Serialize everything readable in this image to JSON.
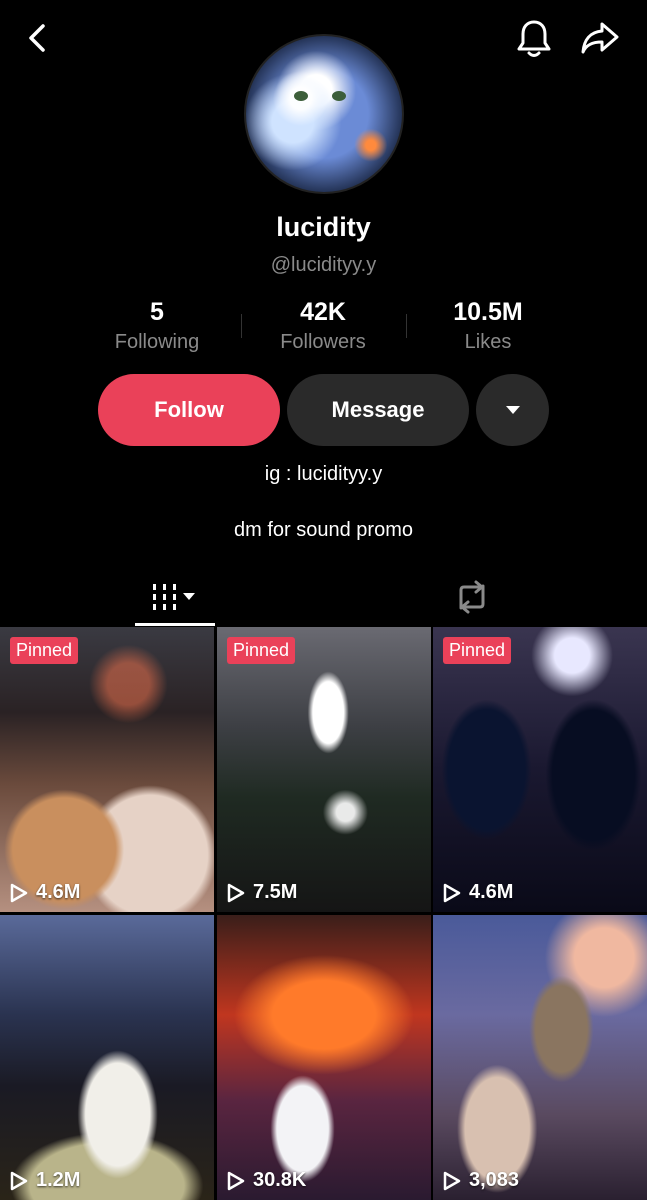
{
  "profile": {
    "name": "lucidity",
    "handle": "@lucidityy.y",
    "bio_line1": "ig : lucidityy.y",
    "bio_line2": "dm for sound promo"
  },
  "stats": [
    {
      "value": "5",
      "label": "Following"
    },
    {
      "value": "42K",
      "label": "Followers"
    },
    {
      "value": "10.5M",
      "label": "Likes"
    }
  ],
  "actions": {
    "follow": "Follow",
    "message": "Message"
  },
  "colors": {
    "accent": "#ea4159",
    "background": "#000000",
    "muted_text": "#8a8a8a",
    "button_dark": "#2a2a2a"
  },
  "icons": {
    "back": "chevron-left-icon",
    "notifications": "bell-icon",
    "share": "share-arrow-icon",
    "more": "triangle-down-icon",
    "videos_tab": "grid-bars-icon",
    "reposts_tab": "repost-icon",
    "play": "play-outline-icon"
  },
  "videos": [
    {
      "pinned": "Pinned",
      "views": "4.6M"
    },
    {
      "pinned": "Pinned",
      "views": "7.5M"
    },
    {
      "pinned": "Pinned",
      "views": "4.6M"
    },
    {
      "pinned": "",
      "views": "1.2M"
    },
    {
      "pinned": "",
      "views": "30.8K"
    },
    {
      "pinned": "",
      "views": "3,083"
    }
  ]
}
